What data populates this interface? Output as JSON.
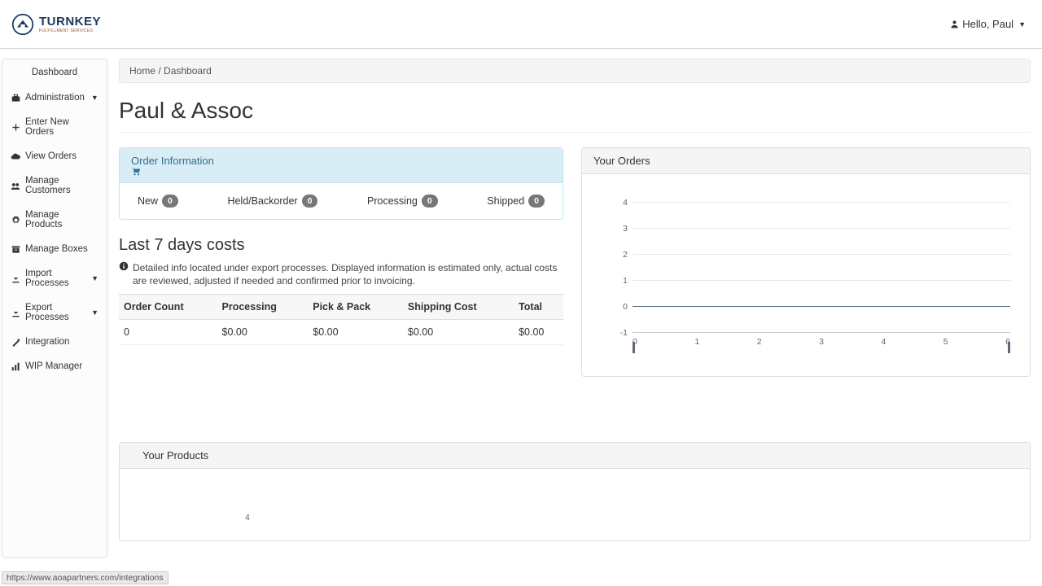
{
  "brand": {
    "name": "TURNKEY",
    "subtitle": "FULFILLMENT SERVICES"
  },
  "user": {
    "greeting": "Hello, Paul"
  },
  "sidebar": {
    "items": [
      {
        "label": "Dashboard"
      },
      {
        "label": "Administration"
      },
      {
        "label": "Enter New Orders"
      },
      {
        "label": "View Orders"
      },
      {
        "label": "Manage Customers"
      },
      {
        "label": "Manage Products"
      },
      {
        "label": "Manage Boxes"
      },
      {
        "label": "Import Processes"
      },
      {
        "label": "Export Processes"
      },
      {
        "label": "Integration"
      },
      {
        "label": "WIP Manager"
      }
    ]
  },
  "breadcrumb": {
    "home": "Home",
    "sep": "/",
    "current": "Dashboard"
  },
  "page_title": "Paul & Assoc",
  "order_info": {
    "heading": "Order Information",
    "stats": [
      {
        "label": "New",
        "value": "0"
      },
      {
        "label": "Held/Backorder",
        "value": "0"
      },
      {
        "label": "Processing",
        "value": "0"
      },
      {
        "label": "Shipped",
        "value": "0"
      }
    ]
  },
  "costs": {
    "heading": "Last 7 days costs",
    "note": "Detailed info located under export processes. Displayed information is estimated only, actual costs are reviewed, adjusted if needed and confirmed prior to invoicing.",
    "columns": [
      "Order Count",
      "Processing",
      "Pick & Pack",
      "Shipping Cost",
      "Total"
    ],
    "row": [
      "0",
      "$0.00",
      "$0.00",
      "$0.00",
      "$0.00"
    ]
  },
  "orders_chart": {
    "heading": "Your Orders"
  },
  "chart_data": {
    "type": "line",
    "x": [
      0,
      1,
      2,
      3,
      4,
      5,
      6
    ],
    "values": [
      0,
      0,
      0,
      0,
      0,
      0,
      0
    ],
    "y_ticks": [
      -1,
      0,
      1,
      2,
      3,
      4
    ],
    "x_ticks": [
      0,
      1,
      2,
      3,
      4,
      5,
      6
    ],
    "ylim": [
      -1,
      4
    ],
    "xlabel": "",
    "ylabel": ""
  },
  "products": {
    "heading": "Your Products",
    "y_tick": "4"
  },
  "status_url": "https://www.aoapartners.com/integrations"
}
